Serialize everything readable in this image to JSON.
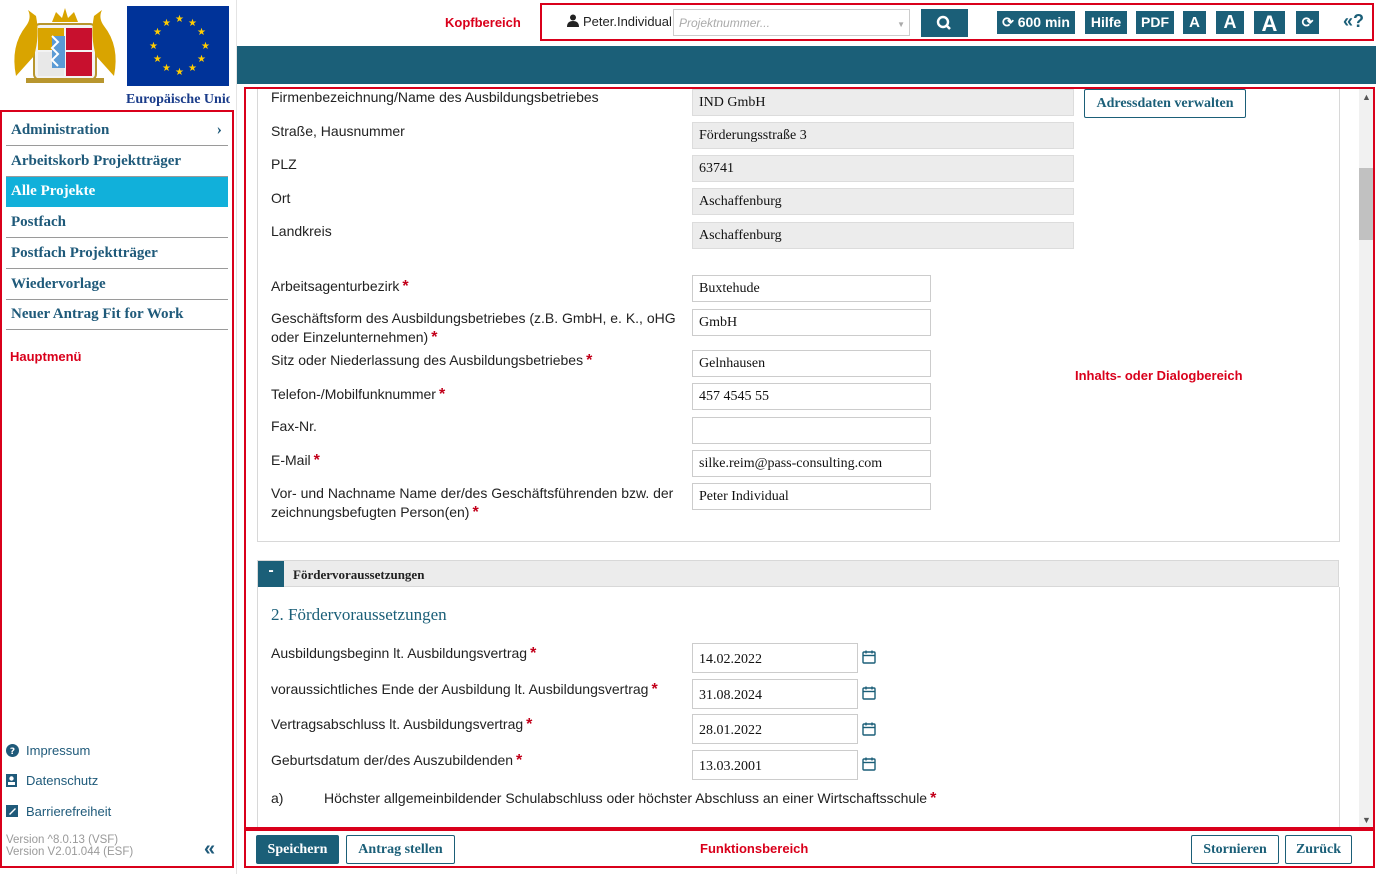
{
  "logo": {
    "eu_text": "Europäische Union"
  },
  "sidebar": {
    "items": [
      {
        "label": "Administration"
      },
      {
        "label": "Arbeitskorb Projektträger"
      },
      {
        "label": "Alle Projekte"
      },
      {
        "label": "Postfach"
      },
      {
        "label": "Postfach Projektträger"
      },
      {
        "label": "Wiedervorlage"
      },
      {
        "label": "Neuer Antrag Fit for Work"
      }
    ],
    "annotation": "Hauptmenü",
    "footer_links": [
      {
        "label": "Impressum",
        "icon": "help-circle-icon"
      },
      {
        "label": "Datenschutz",
        "icon": "user-badge-icon"
      },
      {
        "label": "Barrierefreiheit",
        "icon": "edit-square-icon"
      }
    ],
    "version_line1": "Version ^8.0.13 (VSF)",
    "version_line2": "Version V2.01.044 (ESF)"
  },
  "header": {
    "annotation": "Kopfbereich",
    "user": "Peter.Individual",
    "project_placeholder": "Projektnummer...",
    "session_timer": "600 min",
    "help_label": "Hilfe",
    "pdf_label": "PDF",
    "font_small": "A",
    "font_medium": "A",
    "font_large": "A",
    "help_toggle": "«?"
  },
  "content": {
    "annotation": "Inhalts- oder Dialogbereich",
    "address_button": "Adressdaten verwalten",
    "fields1": [
      {
        "label": "Firmenbezeichnung/Name des Ausbildungsbetriebes",
        "value": "IND GmbH"
      },
      {
        "label": "Straße, Hausnummer",
        "value": "Förderungsstraße 3"
      },
      {
        "label": "PLZ",
        "value": "63741"
      },
      {
        "label": "Ort",
        "value": "Aschaffenburg"
      },
      {
        "label": "Landkreis",
        "value": "Aschaffenburg"
      }
    ],
    "fields2": [
      {
        "label": "Arbeitsagenturbezirk",
        "value": "Buxtehude"
      },
      {
        "label": "Geschäftsform des Ausbildungsbetriebes (z.B. GmbH, e. K., oHG",
        "label2": "oder Einzelunternehmen)",
        "value": "GmbH"
      },
      {
        "label": "Sitz oder Niederlassung des Ausbildungsbetriebes",
        "value": "Gelnhausen"
      },
      {
        "label": "Telefon-/Mobilfunknummer",
        "value": "457 4545 55"
      },
      {
        "label": "Fax-Nr.",
        "value": ""
      },
      {
        "label": "E-Mail",
        "value": "silke.reim@pass-consulting.com"
      },
      {
        "label": "Vor- und Nachname Name der/des Geschäftsführenden bzw. der",
        "label2": "zeichnungsbefugten Person(en)",
        "value": "Peter Individual"
      }
    ],
    "section": {
      "toggle": "-",
      "title": "Fördervoraussetzungen",
      "heading": "2. Fördervoraussetzungen",
      "dates": [
        {
          "label": "Ausbildungsbeginn lt. Ausbildungsvertrag",
          "value": "14.02.2022"
        },
        {
          "label": "voraussichtliches Ende der Ausbildung lt. Ausbildungsvertrag",
          "value": "31.08.2024"
        },
        {
          "label": "Vertragsabschluss lt. Ausbildungsvertrag",
          "value": "28.01.2022"
        },
        {
          "label": "Geburtsdatum der/des Auszubildenden",
          "value": "13.03.2001"
        }
      ],
      "question_letter": "a)",
      "question_text": "Höchster allgemeinbildender Schulabschluss oder höchster Abschluss an einer Wirtschaftsschule"
    }
  },
  "footer": {
    "annotation": "Funktionsbereich",
    "save": "Speichern",
    "submit": "Antrag stellen",
    "cancel": "Stornieren",
    "back": "Zurück"
  },
  "required_mark": "*"
}
